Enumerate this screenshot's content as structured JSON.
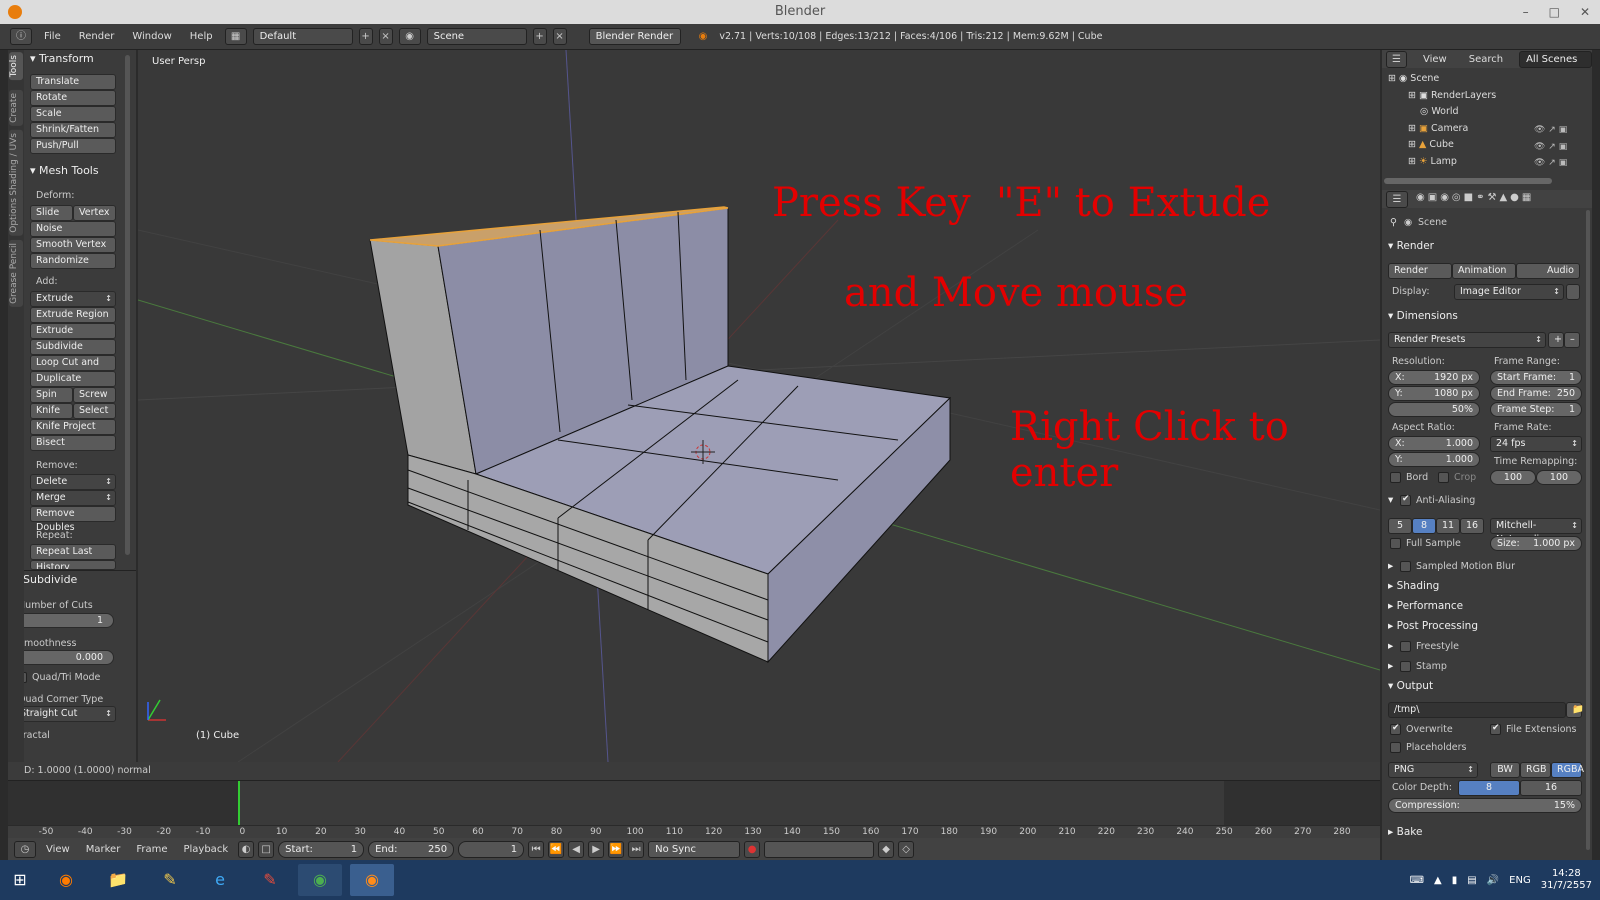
{
  "window": {
    "title": "Blender"
  },
  "menubar": {
    "menus": [
      "File",
      "Render",
      "Window",
      "Help"
    ],
    "layout": "Default",
    "scene": "Scene",
    "engine": "Blender Render",
    "stats": "v2.71 | Verts:10/108 | Edges:13/212 | Faces:4/106 | Tris:212 | Mem:9.62M | Cube"
  },
  "tool_tabs": [
    "Tools",
    "Create",
    "Shading / UVs",
    "Options",
    "Grease Pencil"
  ],
  "toolshelf": {
    "transform_header": "Transform",
    "transform": [
      "Translate",
      "Rotate",
      "Scale",
      "Shrink/Fatten",
      "Push/Pull"
    ],
    "mesh_header": "Mesh Tools",
    "deform_label": "Deform:",
    "slide_edge": "Slide Ed",
    "vertex": "Vertex",
    "deform": [
      "Noise",
      "Smooth Vertex",
      "Randomize"
    ],
    "add_label": "Add:",
    "extrude": "Extrude",
    "add": [
      "Extrude Region",
      "Extrude Individual",
      "Subdivide",
      "Loop Cut and Slide",
      "Duplicate"
    ],
    "spin": "Spin",
    "screw": "Screw",
    "knife": "Knife",
    "select": "Select",
    "add2": [
      "Knife Project",
      "Bisect"
    ],
    "remove_label": "Remove:",
    "delete": "Delete",
    "merge": "Merge",
    "remove_doubles": "Remove Doubles",
    "repeat_label": "Repeat:",
    "repeat_last": "Repeat Last",
    "history": "History",
    "subdivide_header": "Subdivide",
    "num_cuts_label": "Number of Cuts",
    "num_cuts": "1",
    "smooth_label": "Smoothness",
    "smooth": "0.000",
    "quadtri": "Quad/Tri Mode",
    "quad_corner_label": "Quad Corner Type",
    "quad_corner": "Straight Cut",
    "fractal_label": "Fractal"
  },
  "viewport": {
    "view_label": "User Persp",
    "object_label": "(1) Cube",
    "annotation1": "Press Key  \"E\" to Extude",
    "annotation2": "and Move mouse",
    "annotation3": "Right Click to enter"
  },
  "status_line": "D: 1.0000 (1.0000) normal",
  "timeline": {
    "ticks": [
      "-50",
      "-40",
      "-30",
      "-20",
      "-10",
      "0",
      "10",
      "20",
      "30",
      "40",
      "50",
      "60",
      "70",
      "80",
      "90",
      "100",
      "110",
      "120",
      "130",
      "140",
      "150",
      "160",
      "170",
      "180",
      "190",
      "200",
      "210",
      "220",
      "230",
      "240",
      "250",
      "260",
      "270",
      "280"
    ],
    "current_frame": 1,
    "menus": [
      "View",
      "Marker",
      "Frame",
      "Playback"
    ],
    "start": "Start:",
    "start_val": "1",
    "end": "End:",
    "end_val": "250",
    "frame": "1",
    "sync": "No Sync"
  },
  "outliner": {
    "view": "View",
    "search": "Search",
    "filter": "All Scenes",
    "items": [
      "Scene",
      "RenderLayers",
      "World",
      "Camera",
      "Cube",
      "Lamp"
    ]
  },
  "properties": {
    "scene": "Scene",
    "render_header": "Render",
    "render_btn": "Render",
    "animation_btn": "Animation",
    "audio_btn": "Audio",
    "display_label": "Display:",
    "display": "Image Editor",
    "dimensions_header": "Dimensions",
    "presets": "Render Presets",
    "resolution_label": "Resolution:",
    "res_x": "X:",
    "res_x_val": "1920 px",
    "res_y": "Y:",
    "res_y_val": "1080 px",
    "res_pct": "50%",
    "frame_range_label": "Frame Range:",
    "start_frame": "Start Frame:",
    "start_frame_val": "1",
    "end_frame": "End Frame:",
    "end_frame_val": "250",
    "frame_step": "Frame Step:",
    "frame_step_val": "1",
    "aspect_label": "Aspect Ratio:",
    "asp_x": "X:",
    "asp_x_val": "1.000",
    "asp_y": "Y:",
    "asp_y_val": "1.000",
    "frame_rate_label": "Frame Rate:",
    "fps": "24 fps",
    "remap_label": "Time Remapping:",
    "remap_old": "100",
    "remap_new": "100",
    "bord": "Bord",
    "crop": "Crop",
    "aa_header": "Anti-Aliasing",
    "aa_samples": [
      "5",
      "8",
      "11",
      "16"
    ],
    "filter": "Mitchell-Netravali",
    "full_sample": "Full Sample",
    "size_label": "Size:",
    "size_val": "1.000 px",
    "collapsed": [
      "Sampled Motion Blur",
      "Shading",
      "Performance",
      "Post Processing",
      "Freestyle",
      "Stamp"
    ],
    "output_header": "Output",
    "path": "/tmp\\",
    "overwrite": "Overwrite",
    "file_ext": "File Extensions",
    "placeholders": "Placeholders",
    "format": "PNG",
    "bw": "BW",
    "rgb": "RGB",
    "rgba": "RGBA",
    "color_depth_label": "Color Depth:",
    "depth8": "8",
    "depth16": "16",
    "compression_label": "Compression:",
    "compression": "15%",
    "bake_header": "Bake"
  },
  "taskbar": {
    "lang": "ENG",
    "time": "14:28",
    "date": "31/7/2557"
  }
}
